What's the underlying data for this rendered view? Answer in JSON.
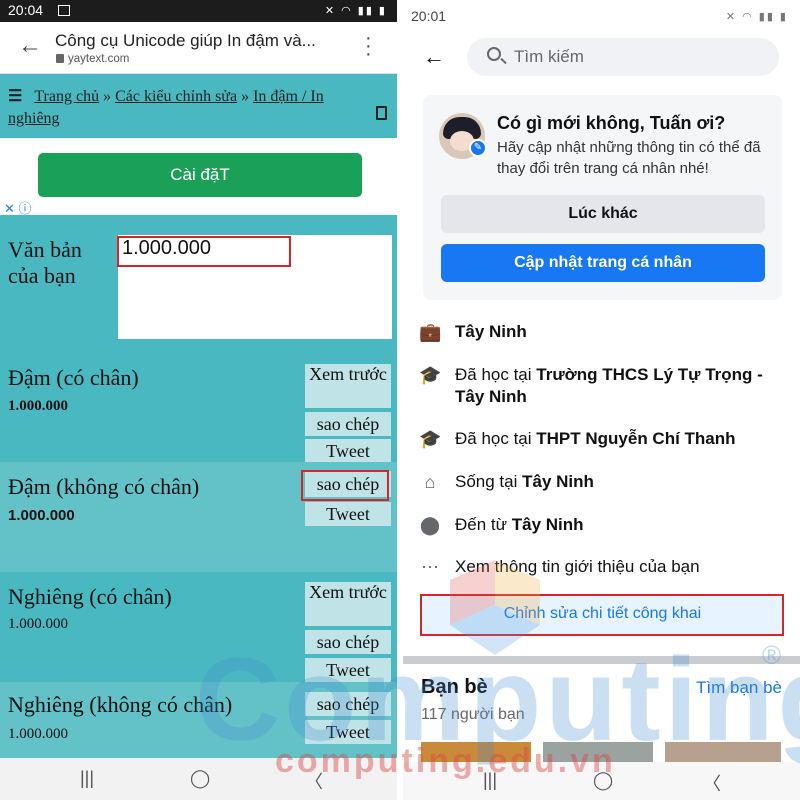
{
  "left": {
    "status_time": "20:04",
    "page_title": "Công cụ Unicode giúp In đậm và...",
    "domain": "yaytext.com",
    "breadcrumb": {
      "home": "Trang chủ",
      "sep": "»",
      "styles": "Các kiểu chỉnh sửa",
      "current_line1": "In đậm / In",
      "current_line2": "nghiêng"
    },
    "install_label": "Cài đặT",
    "input_label_1": "Văn bản",
    "input_label_2": "của bạn",
    "input_value": "1.000.000",
    "sections": [
      {
        "label": "Đậm (có chân)",
        "value": "1.000.000",
        "preview": "Xem trước",
        "copy": "sao chép",
        "tweet": "Tweet"
      },
      {
        "label": "Đậm (không có chân)",
        "value": "1.000.000",
        "copy": "sao chép",
        "tweet": "Tweet"
      },
      {
        "label": "Nghiêng (có chân)",
        "value": "1.000.000",
        "preview": "Xem trước",
        "copy": "sao chép",
        "tweet": "Tweet"
      },
      {
        "label": "Nghiêng (không có chân)",
        "value": "1.000.000",
        "copy": "sao chép",
        "tweet": "Tweet"
      }
    ]
  },
  "right": {
    "status_time": "20:01",
    "search_placeholder": "Tìm kiếm",
    "card": {
      "title": "Có gì mới không, Tuấn ơi?",
      "subtitle": "Hãy cập nhật những thông tin có thể đã thay đổi trên trang cá nhân nhé!",
      "later": "Lúc khác",
      "update": "Cập nhật trang cá nhân"
    },
    "info": {
      "work": "Tây Ninh",
      "school1_prefix": "Đã học tại ",
      "school1": "Trường THCS Lý Tự Trọng - Tây Ninh",
      "school2_prefix": "Đã học tại ",
      "school2": "THPT Nguyễn Chí Thanh",
      "lives_prefix": "Sống tại ",
      "lives": "Tây Ninh",
      "from_prefix": "Đến từ ",
      "from": "Tây Ninh",
      "about": "Xem thông tin giới thiệu của bạn"
    },
    "edit_public": "Chỉnh sửa chi tiết công khai",
    "friends_title": "Bạn bè",
    "find_friends": "Tìm bạn bè",
    "friends_count": "117 người bạn"
  },
  "watermark": {
    "main": "Computing",
    "sub": "computing.edu.vn",
    "reg": "®"
  },
  "colors": {
    "teal": "#4ab8c0",
    "fb_blue": "#1877f2",
    "install_green": "#1ba058",
    "highlight_red": "#d9252a"
  }
}
